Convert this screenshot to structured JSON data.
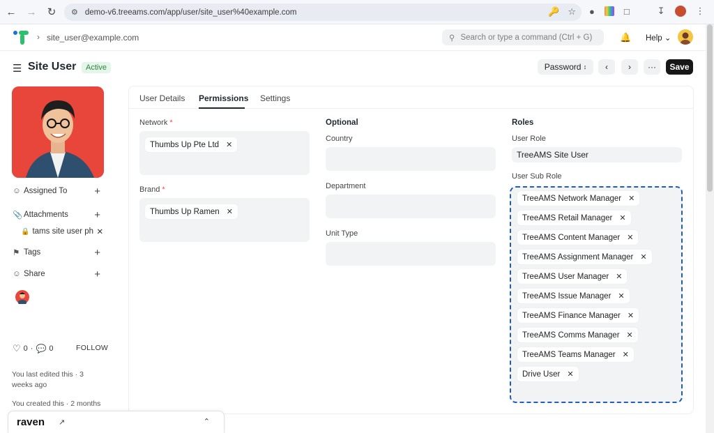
{
  "browser": {
    "url": "demo-v6.treeams.com/app/user/site_user%40example.com"
  },
  "header": {
    "breadcrumb": "site_user@example.com",
    "search_placeholder": "Search or type a command (Ctrl + G)",
    "help_label": "Help"
  },
  "page": {
    "title": "Site User",
    "status": "Active",
    "password_label": "Password",
    "more_label": "···",
    "save_label": "Save"
  },
  "sidebar": {
    "assigned_to": "Assigned To",
    "attachments": "Attachments",
    "attachment_item": "tams site user ph",
    "tags": "Tags",
    "share": "Share",
    "likes": "0",
    "comments": "0",
    "follow": "FOLLOW",
    "edited": "You last edited this · 3 weeks ago",
    "created": "You created this · 2 months"
  },
  "tabs": [
    "User Details",
    "Permissions",
    "Settings"
  ],
  "form": {
    "network_label": "Network",
    "network_value": "Thumbs Up Pte Ltd",
    "brand_label": "Brand",
    "brand_value": "Thumbs Up Ramen",
    "optional_heading": "Optional",
    "country_label": "Country",
    "department_label": "Department",
    "unit_type_label": "Unit Type",
    "roles_heading": "Roles",
    "user_role_label": "User Role",
    "user_role_value": "TreeAMS Site User",
    "user_sub_role_label": "User Sub Role",
    "sub_roles": [
      "TreeAMS Network Manager",
      "TreeAMS Retail Manager",
      "TreeAMS Content Manager",
      "TreeAMS Assignment Manager",
      "TreeAMS User Manager",
      "TreeAMS Issue Manager",
      "TreeAMS Finance Manager",
      "TreeAMS Comms Manager",
      "TreeAMS Teams Manager",
      "Drive User"
    ]
  },
  "raven": {
    "name": "raven"
  }
}
